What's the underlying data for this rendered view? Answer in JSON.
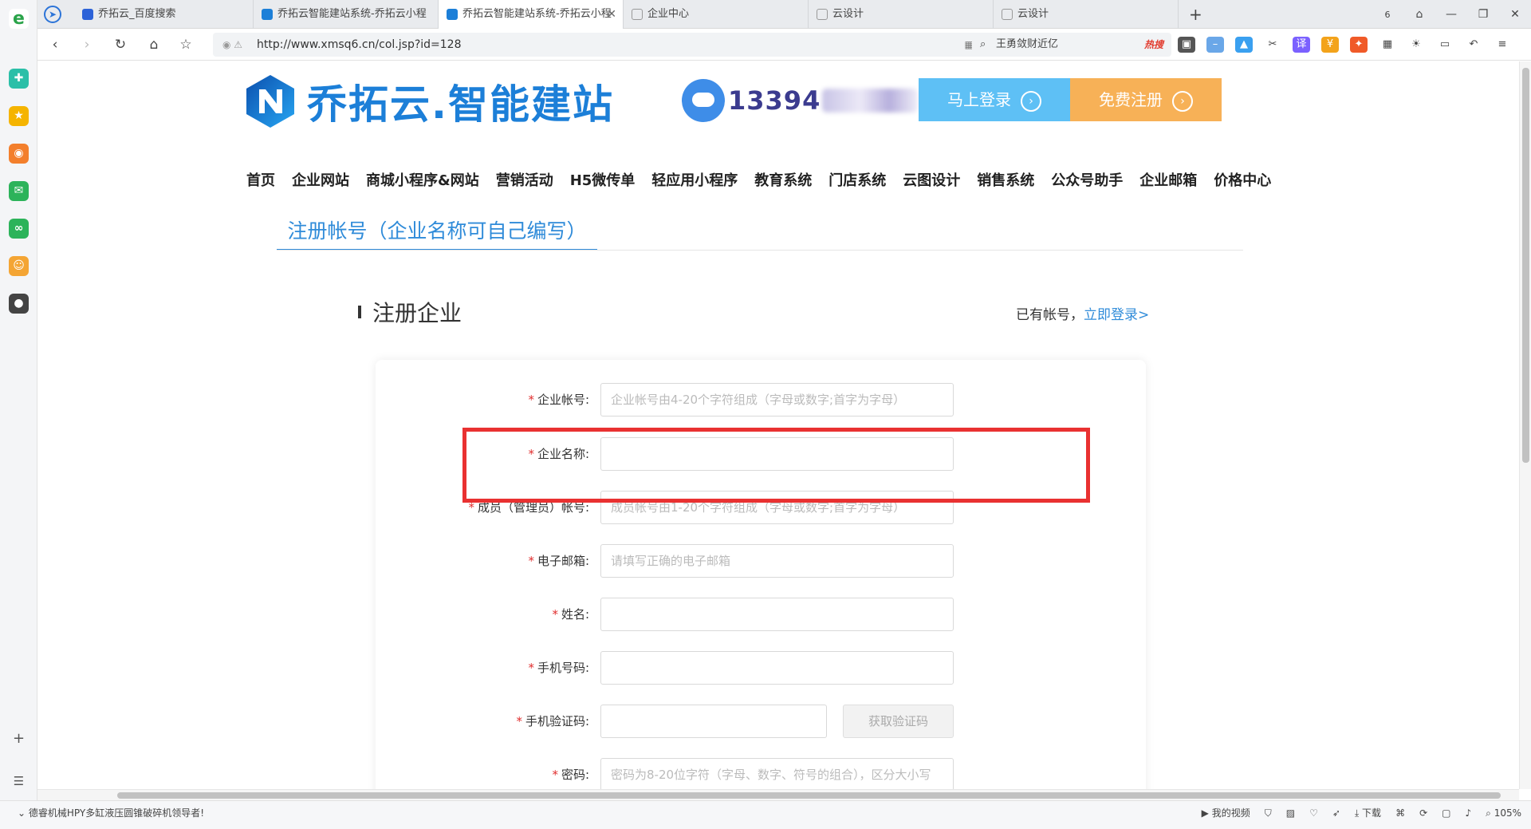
{
  "browser": {
    "tabs": [
      {
        "label": "乔拓云_百度搜索",
        "icon_color": "#2c62d8"
      },
      {
        "label": "乔拓云智能建站系统-乔拓云小程",
        "icon_color": "#1c7fd8"
      },
      {
        "label": "乔拓云智能建站系统-乔拓云小程",
        "icon_color": "#1c7fd8",
        "active": true
      },
      {
        "label": "企业中心",
        "icon_color": "#999999"
      },
      {
        "label": "云设计",
        "icon_color": "#999999"
      },
      {
        "label": "云设计",
        "icon_color": "#999999"
      }
    ],
    "new_tab": "+",
    "tab_count": "6",
    "url": "http://www.xmsq6.cn/col.jsp?id=128",
    "search_text": "王勇敛财近亿",
    "search_hot": "热搜",
    "zoom": "105%",
    "status_message": "德睿机械HPY多缸液压圆锥破碎机领导者!",
    "status_videos": "我的视频",
    "status_download": "下载"
  },
  "site": {
    "logo_text": "乔拓云.智能建站",
    "phone_visible": "13394",
    "login_button": "马上登录",
    "register_button": "免费注册",
    "menu": [
      "首页",
      "企业网站",
      "商城小程序&网站",
      "营销活动",
      "H5微传单",
      "轻应用小程序",
      "教育系统",
      "门店系统",
      "云图设计",
      "销售系统",
      "公众号助手",
      "企业邮箱",
      "价格中心"
    ],
    "register_tab": "注册帐号（企业名称可自己编写）",
    "section_title": "注册企业",
    "have_account": "已有帐号，",
    "login_now": "立即登录>"
  },
  "form": {
    "fields": [
      {
        "label": "企业帐号:",
        "placeholder": "企业帐号由4-20个字符组成（字母或数字;首字为字母）"
      },
      {
        "label": "企业名称:",
        "placeholder": ""
      },
      {
        "label": "成员（管理员）帐号:",
        "placeholder": "成员帐号由1-20个字符组成（字母或数字;首字为字母）"
      },
      {
        "label": "电子邮箱:",
        "placeholder": "请填写正确的电子邮箱"
      },
      {
        "label": "姓名:",
        "placeholder": ""
      },
      {
        "label": "手机号码:",
        "placeholder": ""
      },
      {
        "label": "手机验证码:",
        "placeholder": ""
      },
      {
        "label": "密码:",
        "placeholder": "密码为8-20位字符（字母、数字、符号的组合），区分大小写"
      }
    ],
    "required_mark": "*",
    "get_code_button": "获取验证码"
  },
  "colors": {
    "accent": "#2f8bd9",
    "login_bg": "#5ec0f5",
    "register_bg": "#f7b157",
    "highlight": "#e93131"
  }
}
